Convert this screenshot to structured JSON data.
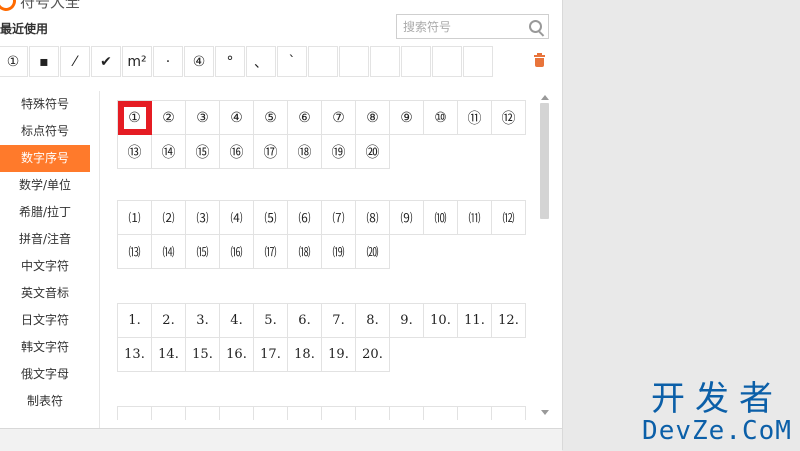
{
  "app": {
    "title": "符号大全"
  },
  "recent": {
    "label": "最近使用",
    "symbols": [
      "①",
      "▪",
      "⁄",
      "✔",
      "m²",
      "·",
      "④",
      "°",
      "、",
      "`",
      "",
      "",
      "",
      "",
      "",
      ""
    ]
  },
  "search": {
    "placeholder": "搜索符号"
  },
  "sidebar": {
    "items": [
      {
        "label": "特殊符号",
        "active": false
      },
      {
        "label": "标点符号",
        "active": false
      },
      {
        "label": "数字序号",
        "active": true
      },
      {
        "label": "数学/单位",
        "active": false
      },
      {
        "label": "希腊/拉丁",
        "active": false
      },
      {
        "label": "拼音/注音",
        "active": false
      },
      {
        "label": "中文字符",
        "active": false
      },
      {
        "label": "英文音标",
        "active": false
      },
      {
        "label": "日文字符",
        "active": false
      },
      {
        "label": "韩文字符",
        "active": false
      },
      {
        "label": "俄文字母",
        "active": false
      },
      {
        "label": "制表符",
        "active": false
      }
    ]
  },
  "groups": [
    {
      "symbols": [
        "①",
        "②",
        "③",
        "④",
        "⑤",
        "⑥",
        "⑦",
        "⑧",
        "⑨",
        "⑩",
        "⑪",
        "⑫",
        "⑬",
        "⑭",
        "⑮",
        "⑯",
        "⑰",
        "⑱",
        "⑲",
        "⑳"
      ],
      "selected_index": 0
    },
    {
      "symbols": [
        "⑴",
        "⑵",
        "⑶",
        "⑷",
        "⑸",
        "⑹",
        "⑺",
        "⑻",
        "⑼",
        "⑽",
        "⑾",
        "⑿",
        "⒀",
        "⒁",
        "⒂",
        "⒃",
        "⒄",
        "⒅",
        "⒆",
        "⒇"
      ]
    },
    {
      "symbols": [
        "1.",
        "2.",
        "3.",
        "4.",
        "5.",
        "6.",
        "7.",
        "8.",
        "9.",
        "10.",
        "11.",
        "12.",
        "13.",
        "14.",
        "15.",
        "16.",
        "17.",
        "18.",
        "19.",
        "20."
      ]
    }
  ],
  "watermark": {
    "cn": "开发者",
    "en": "DevZe.CoM"
  },
  "colors": {
    "accent": "#ff7a2b",
    "selection": "#e51c23",
    "watermark": "#0b5fa8"
  },
  "icons": {
    "search": "search-icon",
    "delete": "trash-icon"
  }
}
